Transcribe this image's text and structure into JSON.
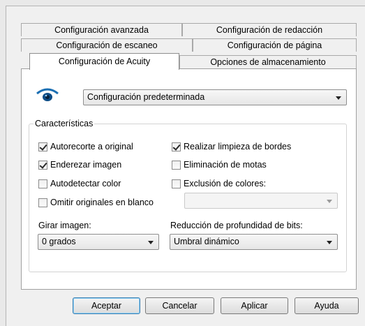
{
  "tabs": {
    "row1": [
      "Configuración avanzada",
      "Configuración de redacción"
    ],
    "row2": [
      "Configuración de escaneo",
      "Configuración de página"
    ],
    "row3_active": "Configuración de Acuity",
    "row3_other": "Opciones de almacenamiento"
  },
  "preset": {
    "icon": "eye-icon",
    "value": "Configuración predeterminada"
  },
  "features": {
    "title": "Características",
    "checkboxes": [
      {
        "label": "Autorecorte a original",
        "checked": true
      },
      {
        "label": "Realizar limpieza de bordes",
        "checked": true
      },
      {
        "label": "Enderezar imagen",
        "checked": true
      },
      {
        "label": "Eliminación de motas",
        "checked": false
      },
      {
        "label": "Autodetectar color",
        "checked": false
      },
      {
        "label": "Exclusión de colores:",
        "checked": false
      },
      {
        "label": "Omitir originales en blanco",
        "checked": false
      }
    ],
    "color_select_value": ""
  },
  "rotate": {
    "label": "Girar imagen:",
    "value": "0 grados"
  },
  "bitdepth": {
    "label": "Reducción de profundidad de bits:",
    "value": "Umbral dinámico"
  },
  "buttons": {
    "ok": "Aceptar",
    "cancel": "Cancelar",
    "apply": "Aplicar",
    "help": "Ayuda"
  },
  "colors": {
    "eye_blue": "#1b6fb3",
    "default_button_border": "#3c7fb1"
  }
}
